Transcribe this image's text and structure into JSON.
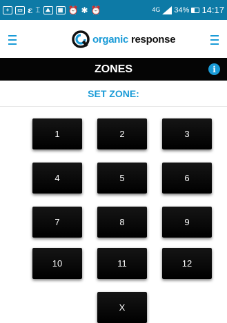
{
  "status_bar": {
    "time": "14:17",
    "battery_percent": "34%",
    "battery_level": 0.34,
    "network": "4G",
    "network_sub": "LTE",
    "icons": [
      "plus-box-icon",
      "image-icon",
      "e-icon",
      "bluetooth-file-icon",
      "picture-icon",
      "calendar-icon",
      "alarm-icon",
      "bluetooth-icon",
      "alarm-icon",
      "signal-icon",
      "battery-icon"
    ]
  },
  "app": {
    "logo_organic": "organic",
    "logo_response": "response",
    "brand_color": "#1a9bd7"
  },
  "zones": {
    "title": "ZONES",
    "info_label": "i",
    "set_zone_label": "SET ZONE:"
  },
  "keypad": {
    "keys": [
      "1",
      "2",
      "3",
      "4",
      "5",
      "6",
      "7",
      "8",
      "9",
      "10",
      "11",
      "12",
      "X"
    ]
  }
}
